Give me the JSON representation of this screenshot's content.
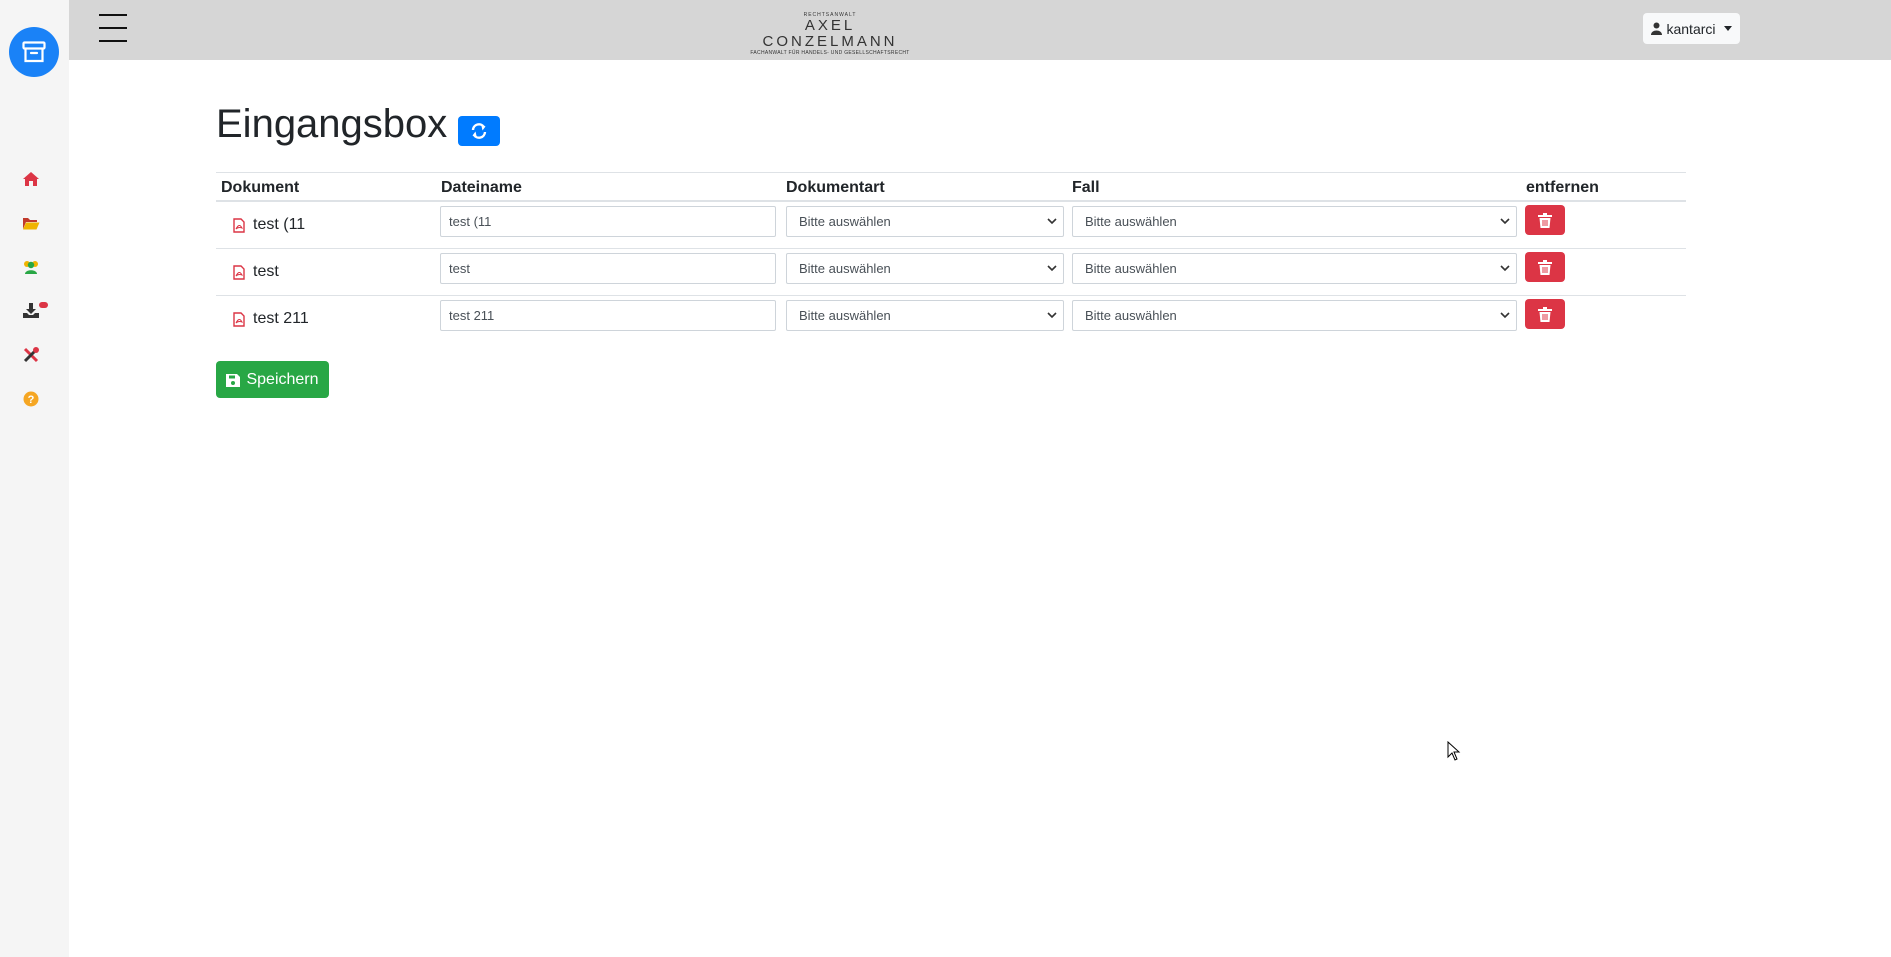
{
  "sidebar": {
    "brand_icon": "archive-box-icon",
    "items": [
      {
        "icon": "home-icon",
        "color": "#dc3545"
      },
      {
        "icon": "folder-open-icon",
        "color": "#c0392b"
      },
      {
        "icon": "users-icon",
        "color": "#28a745"
      },
      {
        "icon": "inbox-download-icon",
        "color": "#333333",
        "badge": true
      },
      {
        "icon": "tools-icon",
        "color": "#dc3545"
      },
      {
        "icon": "help-circle-icon",
        "color": "#f5a623"
      }
    ]
  },
  "topbar": {
    "logo_top": "RECHTSANWALT",
    "logo_main": "AXEL CONZELMANN",
    "logo_sub": "FACHANWALT FÜR HANDELS- UND GESELLSCHAFTSRECHT",
    "user": "kantarci"
  },
  "page": {
    "title": "Eingangsbox"
  },
  "table": {
    "headers": [
      "Dokument",
      "Dateiname",
      "Dokumentart",
      "Fall",
      "entfernen"
    ],
    "rows": [
      {
        "document": "test (11",
        "filename": "test (11",
        "doctype": "Bitte auswählen",
        "case": "Bitte auswählen"
      },
      {
        "document": "test",
        "filename": "test",
        "doctype": "Bitte auswählen",
        "case": "Bitte auswählen"
      },
      {
        "document": "test 211",
        "filename": "test 211",
        "doctype": "Bitte auswählen",
        "case": "Bitte auswählen"
      }
    ]
  },
  "actions": {
    "save_label": "Speichern"
  },
  "colors": {
    "primary": "#007bff",
    "danger": "#dc3545",
    "success": "#28a745"
  }
}
